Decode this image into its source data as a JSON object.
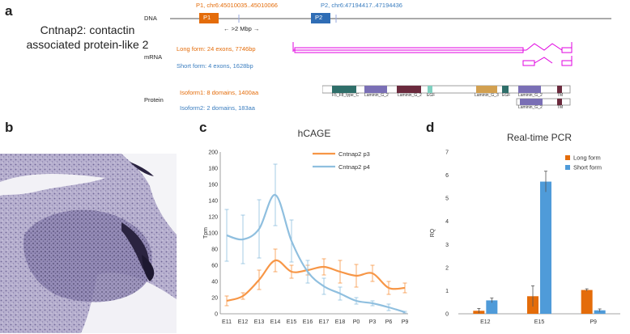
{
  "panel_a": {
    "letter": "a",
    "title_line1": "Cntnap2: contactin",
    "title_line2": "associated protein-like 2",
    "dna_label": "DNA",
    "p1_coords": "P1, chr6:45010035..45010066",
    "p2_coords": "P2, chr6:47194417..47194436",
    "p1_box": "P1",
    "p2_box": "P2",
    "distance": "← >2 Mbp →",
    "mrna_label": "mRNA",
    "long_form": "Long form: 24 exons, 7746bp",
    "short_form": "Short form: 4 exons, 1628bp",
    "protein_label": "Protein",
    "isoform1": "Isoform1: 8 domains, 1400aa",
    "isoform2": "Isoform2: 2 domains, 183aa",
    "domains": [
      "F5_F8_type_C",
      "Laminin_G_2",
      "Laminin_G_2",
      "EGF",
      "Laminin_G_3",
      "EGF",
      "Laminin_G_2",
      "TM"
    ],
    "domains_short": [
      "Laminin_G_2",
      "TM"
    ],
    "colors": {
      "orange": "#e46c0a",
      "blue": "#3a7dbf",
      "magenta": "#e000e0"
    }
  },
  "panel_b": {
    "letter": "b"
  },
  "panel_c": {
    "letter": "c"
  },
  "panel_d": {
    "letter": "d"
  },
  "chart_data": [
    {
      "type": "line",
      "title": "hCAGE",
      "ylabel": "Tpm",
      "xlabel": "",
      "categories": [
        "E11",
        "E12",
        "E13",
        "E14",
        "E15",
        "E16",
        "E17",
        "E18",
        "P0",
        "P3",
        "P6",
        "P9"
      ],
      "ylim": [
        0,
        200
      ],
      "yticks": [
        0,
        20,
        40,
        60,
        80,
        100,
        120,
        140,
        160,
        180,
        200
      ],
      "legend_position": "top-right",
      "series": [
        {
          "name": "Cntnap2 p3",
          "color": "#f79646",
          "values": [
            16,
            22,
            42,
            66,
            52,
            54,
            58,
            52,
            47,
            50,
            32,
            32
          ],
          "errors": [
            6,
            4,
            12,
            14,
            8,
            6,
            10,
            14,
            14,
            10,
            8,
            6
          ]
        },
        {
          "name": "Cntnap2 p4",
          "color": "#8fbfdf",
          "values": [
            97,
            92,
            105,
            147,
            90,
            52,
            34,
            25,
            16,
            13,
            8,
            2
          ],
          "errors": [
            32,
            30,
            36,
            38,
            26,
            14,
            10,
            8,
            4,
            3,
            4,
            1
          ]
        }
      ]
    },
    {
      "type": "bar",
      "title": "Real-time PCR",
      "ylabel": "RQ",
      "xlabel": "",
      "categories": [
        "E12",
        "E15",
        "P9"
      ],
      "ylim": [
        0,
        7
      ],
      "yticks": [
        0,
        1,
        2,
        3,
        4,
        5,
        6,
        7
      ],
      "legend_position": "top-right",
      "series": [
        {
          "name": "Long form",
          "color": "#e46c0a",
          "values": [
            0.13,
            0.76,
            1.03
          ],
          "errors": [
            0.1,
            0.45,
            0.05
          ]
        },
        {
          "name": "Short form",
          "color": "#4f9bd9",
          "values": [
            0.58,
            5.72,
            0.15
          ],
          "errors": [
            0.1,
            0.45,
            0.06
          ]
        }
      ]
    }
  ]
}
